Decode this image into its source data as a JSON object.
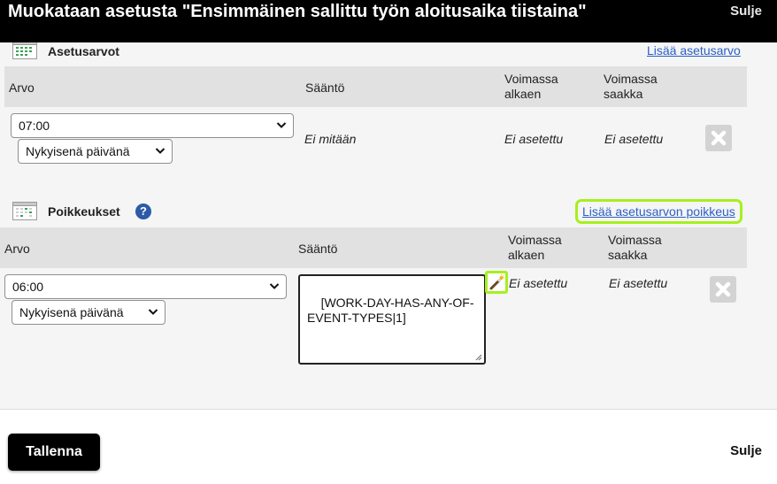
{
  "dialog": {
    "title": "Muokataan asetusta \"Ensimmäinen sallittu työn aloitusaika tiistaina\"",
    "close_label": "Sulje"
  },
  "settings": {
    "title": "Asetusarvot",
    "add_link": "Lisää asetusarvo",
    "headers": {
      "value": "Arvo",
      "rule": "Sääntö",
      "valid_from": "Voimassa alkaen",
      "valid_to": "Voimassa saakka"
    },
    "row": {
      "time": "07:00",
      "day": "Nykyisenä päivänä",
      "rule": "Ei mitään",
      "valid_from": "Ei asetettu",
      "valid_to": "Ei asetettu"
    }
  },
  "exceptions": {
    "title": "Poikkeukset",
    "add_link": "Lisää asetusarvon poikkeus",
    "headers": {
      "value": "Arvo",
      "rule": "Sääntö",
      "valid_from": "Voimassa alkaen",
      "valid_to": "Voimassa saakka"
    },
    "row": {
      "time": "06:00",
      "day": "Nykyisenä päivänä",
      "rule": "[WORK-DAY-HAS-ANY-OF-\nEVENT-TYPES|1]",
      "valid_from": "Ei asetettu",
      "valid_to": "Ei asetettu"
    }
  },
  "footer": {
    "save_label": "Tallenna",
    "close_label": "Sulje"
  },
  "icons": {
    "settings_section": "calendar-grid-icon",
    "exceptions_section": "calendar-icon",
    "help": "help-icon",
    "delete": "close-icon",
    "rule_editor": "magic-wand-icon",
    "dropdown": "chevron-down-icon"
  },
  "colors": {
    "header_bg": "#000000",
    "highlight": "#a6f01f",
    "link": "#2c5fc5",
    "table_header": "#e1e1e1",
    "help_icon": "#2d5aa8"
  }
}
